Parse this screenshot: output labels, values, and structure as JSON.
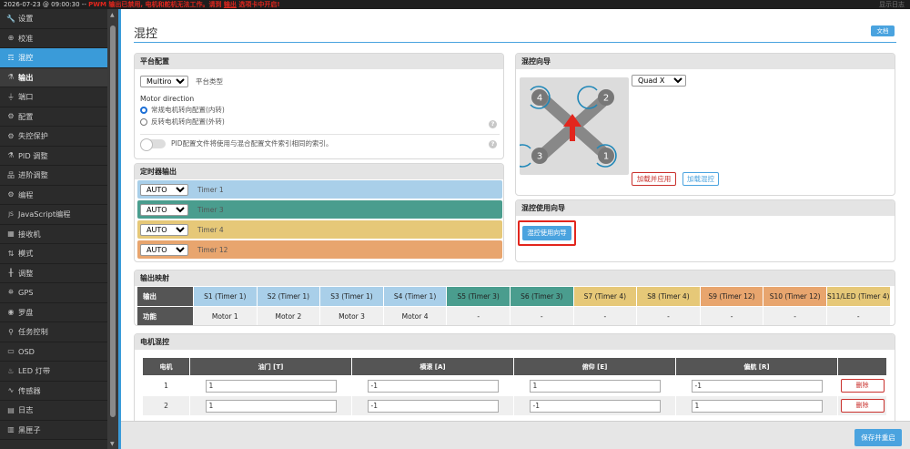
{
  "topbar": {
    "datetime": "2026-07-23 @ 09:00:30 --",
    "warning_pre": "PWM 输出已禁用, 电机和舵机无法工作。请到",
    "warning_link": "输出",
    "warning_post": "选项卡中开启!",
    "show_log": "显示日志"
  },
  "sidebar": {
    "items": [
      {
        "label": "设置",
        "icon": "wrench-icon"
      },
      {
        "label": "校准",
        "icon": "target-icon"
      },
      {
        "label": "混控",
        "icon": "mixer-icon"
      },
      {
        "label": "输出",
        "icon": "flask-icon"
      },
      {
        "label": "端口",
        "icon": "plug-icon"
      },
      {
        "label": "配置",
        "icon": "gear-icon"
      },
      {
        "label": "失控保护",
        "icon": "shield-icon"
      },
      {
        "label": "PID 调整",
        "icon": "sliders-icon"
      },
      {
        "label": "进阶调整",
        "icon": "sitemap-icon"
      },
      {
        "label": "编程",
        "icon": "gear-icon"
      },
      {
        "label": "JavaScript编程",
        "icon": "js-icon"
      },
      {
        "label": "接收机",
        "icon": "receiver-icon"
      },
      {
        "label": "模式",
        "icon": "switch-icon"
      },
      {
        "label": "调整",
        "icon": "adjust-icon"
      },
      {
        "label": "GPS",
        "icon": "satellite-icon"
      },
      {
        "label": "罗盘",
        "icon": "compass-icon"
      },
      {
        "label": "任务控制",
        "icon": "map-pin-icon"
      },
      {
        "label": "OSD",
        "icon": "osd-icon"
      },
      {
        "label": "LED 灯带",
        "icon": "bulb-icon"
      },
      {
        "label": "传感器",
        "icon": "sensor-icon"
      },
      {
        "label": "日志",
        "icon": "log-icon"
      },
      {
        "label": "黑匣子",
        "icon": "blackbox-icon"
      }
    ]
  },
  "page": {
    "title": "混控",
    "doc_button": "文档"
  },
  "platform": {
    "header": "平台配置",
    "platform_value": "Multirotor",
    "platform_type_label": "平台类型",
    "motor_direction_label": "Motor direction",
    "option_normal": "常规电机转向配置(内转)",
    "option_reversed": "反转电机转向配置(外转)",
    "pid_toggle_label": "PID配置文件将使用与混合配置文件索引相同的索引。"
  },
  "timer_output": {
    "header": "定时器输出",
    "rows": [
      {
        "value": "AUTO",
        "label": "Timer 1",
        "color": "#a9cfe9"
      },
      {
        "value": "AUTO",
        "label": "Timer 3",
        "color": "#4a9d8e"
      },
      {
        "value": "AUTO",
        "label": "Timer 4",
        "color": "#e6c878"
      },
      {
        "value": "AUTO",
        "label": "Timer 12",
        "color": "#e8a56e"
      }
    ]
  },
  "mixer_wizard": {
    "header": "混控向导",
    "preset_value": "Quad X",
    "load_apply_button": "加载并应用",
    "load_mixer_button": "加载混控",
    "motors": [
      "4",
      "2",
      "3",
      "1"
    ]
  },
  "mixer_guide": {
    "header": "混控使用向导",
    "button": "混控使用向导"
  },
  "output_mapping": {
    "header": "输出映射",
    "row_output_label": "输出",
    "row_function_label": "功能",
    "columns": [
      {
        "output": "S1 (Timer 1)",
        "function": "Motor 1",
        "color": "#a9cfe9"
      },
      {
        "output": "S2 (Timer 1)",
        "function": "Motor 2",
        "color": "#a9cfe9"
      },
      {
        "output": "S3 (Timer 1)",
        "function": "Motor 3",
        "color": "#a9cfe9"
      },
      {
        "output": "S4 (Timer 1)",
        "function": "Motor 4",
        "color": "#a9cfe9"
      },
      {
        "output": "S5 (Timer 3)",
        "function": "-",
        "color": "#4a9d8e"
      },
      {
        "output": "S6 (Timer 3)",
        "function": "-",
        "color": "#4a9d8e"
      },
      {
        "output": "S7 (Timer 4)",
        "function": "-",
        "color": "#e6c878"
      },
      {
        "output": "S8 (Timer 4)",
        "function": "-",
        "color": "#e6c878"
      },
      {
        "output": "S9 (Timer 12)",
        "function": "-",
        "color": "#e8a56e"
      },
      {
        "output": "S10 (Timer 12)",
        "function": "-",
        "color": "#e8a56e"
      },
      {
        "output": "S11/LED (Timer 4)",
        "function": "-",
        "color": "#e6c878"
      }
    ]
  },
  "motor_mixer": {
    "header": "电机混控",
    "columns": [
      "电机",
      "油门 [T]",
      "横滚 [A]",
      "俯仰 [E]",
      "偏航 [R]",
      ""
    ],
    "rows": [
      {
        "motor": "1",
        "throttle": "1",
        "roll": "-1",
        "pitch": "1",
        "yaw": "-1",
        "delete": "删除"
      },
      {
        "motor": "2",
        "throttle": "1",
        "roll": "-1",
        "pitch": "-1",
        "yaw": "1",
        "delete": "删除"
      }
    ]
  },
  "footer": {
    "save_button": "保存并重启"
  }
}
